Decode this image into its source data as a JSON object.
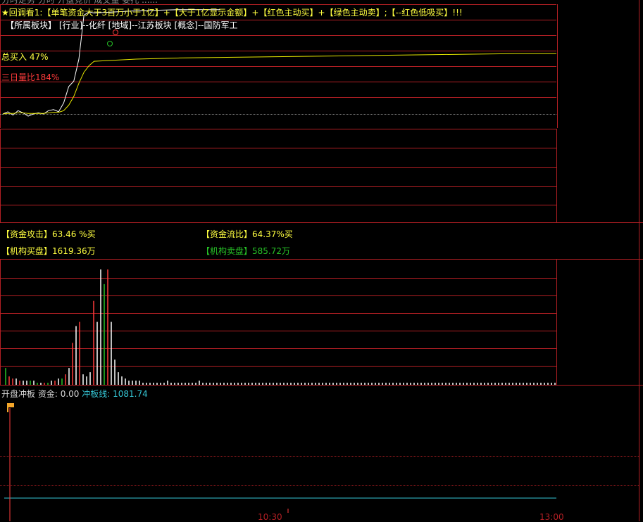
{
  "colors": {
    "background": "#000000",
    "grid_red": "#b31f24",
    "price_white": "#ffffff",
    "avg_yellow": "#e6e600",
    "buy_red": "#ff3b3b",
    "sell_green": "#27c427",
    "neutral_white": "#ffffff",
    "cyan": "#35c7d6",
    "text_yellow": "#ffff40"
  },
  "header": {
    "cut_text": "分时走势  分时 开盘竞价 成交量 委托 ......",
    "star": "★",
    "indicator_title": "回调看",
    "formula_parts": [
      {
        "text": "1:【单笔资金大于3百万小于1亿】+",
        "color": "#ffff40"
      },
      {
        "text": "【大于1亿显示金额】+",
        "color": "#ffff40"
      },
      {
        "text": "【红色主动买】+",
        "color": "#ffff40"
      },
      {
        "text": "【绿色主动卖】;",
        "color": "#ffff40"
      },
      {
        "text": "【--红色低吸买】!!!",
        "color": "#ffff40"
      }
    ],
    "sector_line": "【所属板块】 [行业]--化纤 [地域]--江苏板块 [概念]--国防军工"
  },
  "indicators": {
    "buy_total": "总买入 47%",
    "volume_ratio": "三日量比184%"
  },
  "capital": {
    "attack_label": "【资金攻击】",
    "attack_value": "63.46 %买",
    "flow_label": "【资金流比】",
    "flow_value": "64.37%买",
    "inst_buy_label": "【机构买盘】",
    "inst_buy_value": "1619.36万",
    "inst_sell_label": "【机构卖盘】",
    "inst_sell_value": "585.72万"
  },
  "bottom_indicator": {
    "name": "开盘冲板",
    "fund_label": "资金:",
    "fund_value": "0.00",
    "line_label": "冲板线:",
    "line_value": "1081.74"
  },
  "time_axis": [
    "10:30",
    "13:00"
  ],
  "chart_data": {
    "type": "line",
    "series": [
      {
        "values": [
          0.0,
          0.2,
          -0.1,
          0.3,
          0.1,
          -0.2,
          0.0,
          0.1,
          0.0,
          0.3,
          0.4,
          0.2,
          1.0,
          2.5,
          3.0,
          5.0,
          9.0,
          9.3,
          9.2,
          9.4,
          9.5,
          9.5,
          9.5,
          9.5,
          9.5,
          9.5,
          9.5,
          9.5,
          9.5,
          9.5
        ]
      },
      {
        "values": [
          0.0,
          0.05,
          0.05,
          0.1,
          0.1,
          0.05,
          0.05,
          0.05,
          0.05,
          0.1,
          0.15,
          0.15,
          0.3,
          0.8,
          1.6,
          2.8,
          3.8,
          4.4,
          4.8,
          5.0,
          5.1,
          5.15,
          5.2,
          5.25,
          5.3,
          5.35,
          5.4,
          5.45,
          5.5,
          5.5
        ]
      }
    ],
    "volume": {
      "values": [
        8,
        4,
        3,
        3,
        2,
        2,
        2,
        2,
        2,
        1,
        1,
        1,
        1,
        2,
        2,
        3,
        3,
        5,
        8,
        20,
        28,
        30,
        5,
        4,
        6,
        40,
        30,
        55,
        48,
        55,
        30,
        12,
        6,
        4,
        3,
        2,
        2,
        2,
        2,
        1,
        1,
        1,
        1,
        1,
        1,
        1,
        2,
        1,
        1,
        1,
        1,
        1,
        1,
        1,
        1,
        2,
        1,
        1,
        1,
        1,
        1,
        1,
        1,
        1,
        1,
        1,
        1,
        1,
        1,
        1,
        1,
        1,
        1,
        1,
        1,
        1,
        1,
        1,
        1,
        1,
        1,
        1,
        1,
        1,
        1,
        1,
        1,
        1,
        1,
        1,
        1,
        1,
        1,
        1,
        1,
        1,
        1,
        1,
        1,
        1,
        1,
        1,
        1,
        1,
        1,
        1,
        1,
        1,
        1,
        1,
        1,
        1,
        1,
        1,
        1,
        1,
        1,
        1,
        1,
        1,
        1,
        1,
        1,
        1,
        1,
        1,
        1,
        1,
        1,
        1,
        1,
        1,
        1,
        1,
        1,
        1,
        1,
        1,
        1,
        1,
        1,
        1,
        1,
        1,
        1,
        1,
        1,
        1,
        1,
        1,
        1,
        1,
        1,
        1,
        1,
        1,
        1,
        1
      ],
      "colors": [
        "g",
        "r",
        "r",
        "w",
        "r",
        "w",
        "w",
        "g",
        "w",
        "g",
        "w",
        "r",
        "g",
        "w",
        "r",
        "w",
        "g",
        "r",
        "w",
        "r",
        "w",
        "r",
        "w",
        "w",
        "w",
        "r",
        "w",
        "w",
        "g",
        "r",
        "w",
        "w",
        "w",
        "w",
        "w",
        "w",
        "w",
        "w",
        "w",
        "w",
        "w",
        "w",
        "w",
        "w",
        "w",
        "w",
        "w",
        "w",
        "w",
        "w",
        "w",
        "w",
        "w",
        "w",
        "w",
        "w",
        "w",
        "w",
        "w",
        "w",
        "w",
        "w",
        "w",
        "w",
        "w",
        "w",
        "w",
        "w",
        "w",
        "w",
        "w",
        "w",
        "w",
        "w",
        "w",
        "w",
        "w",
        "w",
        "w",
        "w",
        "w",
        "w",
        "w",
        "w",
        "w",
        "w",
        "w",
        "w",
        "w",
        "w",
        "w",
        "w",
        "w",
        "w",
        "w",
        "w",
        "w",
        "w",
        "w",
        "w",
        "w",
        "w",
        "w",
        "w",
        "w",
        "w",
        "w",
        "w",
        "w",
        "w",
        "w",
        "w",
        "w",
        "w",
        "w",
        "w",
        "w",
        "w",
        "w",
        "w",
        "w",
        "w",
        "w",
        "w",
        "w",
        "w",
        "w",
        "w",
        "w",
        "w",
        "w",
        "w",
        "w",
        "w",
        "w",
        "w",
        "w",
        "w",
        "w",
        "w",
        "w",
        "w",
        "w",
        "w",
        "w",
        "w",
        "w",
        "w",
        "w",
        "w",
        "w",
        "w",
        "w",
        "w",
        "w",
        "w",
        "w",
        "w"
      ]
    },
    "fund_line_level": 1081.74
  }
}
